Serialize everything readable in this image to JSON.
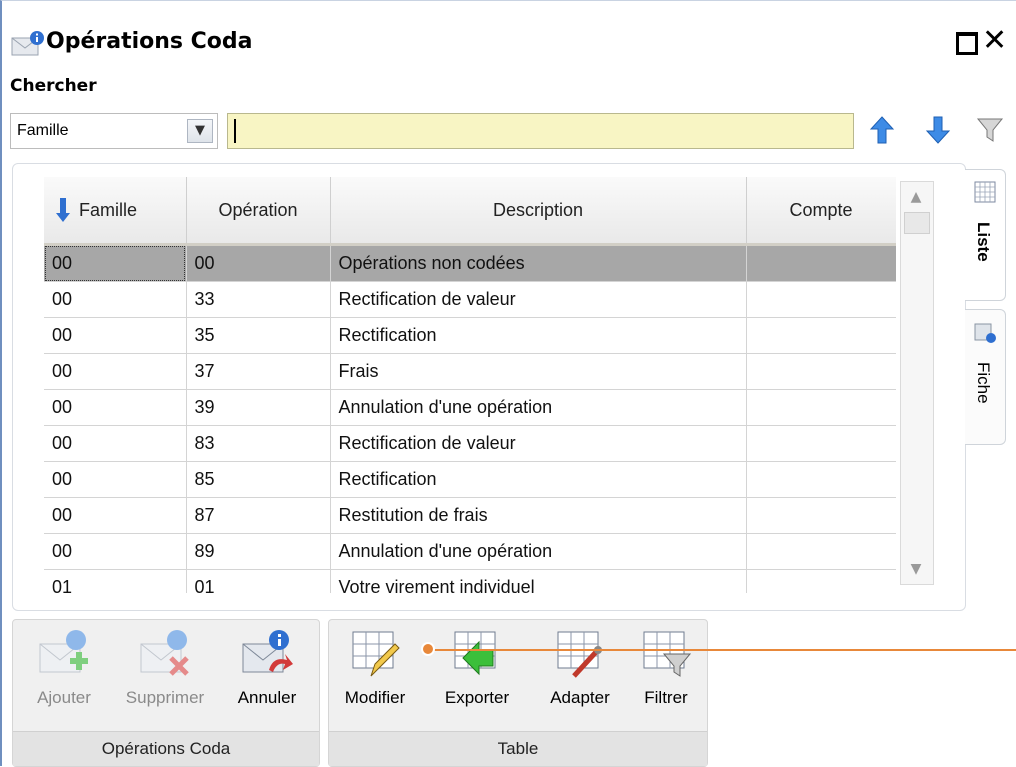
{
  "window": {
    "title": "Opérations Coda"
  },
  "search": {
    "label": "Chercher",
    "field": "Famille",
    "value": "",
    "input_color": "#f8f5c4"
  },
  "table": {
    "columns": [
      "Famille",
      "Opération",
      "Description",
      "Compte"
    ],
    "sorted_column": "Famille",
    "rows": [
      {
        "famille": "00",
        "operation": "00",
        "description": "Opérations non codées",
        "compte": ""
      },
      {
        "famille": "00",
        "operation": "33",
        "description": "Rectification de valeur",
        "compte": ""
      },
      {
        "famille": "00",
        "operation": "35",
        "description": "Rectification",
        "compte": ""
      },
      {
        "famille": "00",
        "operation": "37",
        "description": "Frais",
        "compte": ""
      },
      {
        "famille": "00",
        "operation": "39",
        "description": "Annulation d'une opération",
        "compte": ""
      },
      {
        "famille": "00",
        "operation": "83",
        "description": "Rectification de valeur",
        "compte": ""
      },
      {
        "famille": "00",
        "operation": "85",
        "description": "Rectification",
        "compte": ""
      },
      {
        "famille": "00",
        "operation": "87",
        "description": "Restitution de frais",
        "compte": ""
      },
      {
        "famille": "00",
        "operation": "89",
        "description": "Annulation d'une opération",
        "compte": ""
      },
      {
        "famille": "01",
        "operation": "01",
        "description": "Votre virement individuel",
        "compte": ""
      }
    ],
    "selected_row": 0
  },
  "side_tabs": [
    {
      "label": "Liste",
      "icon": "grid-icon",
      "active": true
    },
    {
      "label": "Fiche",
      "icon": "record-card-icon",
      "active": false
    }
  ],
  "ribbon": {
    "coda_group": {
      "label": "Opérations Coda",
      "buttons": [
        {
          "label": "Ajouter",
          "icon": "envelope-add-icon",
          "enabled": false
        },
        {
          "label": "Supprimer",
          "icon": "envelope-delete-icon",
          "enabled": false
        },
        {
          "label": "Annuler",
          "icon": "envelope-undo-icon",
          "enabled": true
        }
      ]
    },
    "table_group": {
      "label": "Table",
      "buttons": [
        {
          "label": "Modifier",
          "icon": "table-edit-icon"
        },
        {
          "label": "Exporter",
          "icon": "table-export-icon"
        },
        {
          "label": "Adapter",
          "icon": "table-adapt-icon"
        },
        {
          "label": "Filtrer",
          "icon": "table-filter-icon"
        }
      ]
    }
  },
  "colors": {
    "accent": "#2f6fd0",
    "annotation": "#e8883a",
    "selected_row": "#a7a7a7"
  }
}
